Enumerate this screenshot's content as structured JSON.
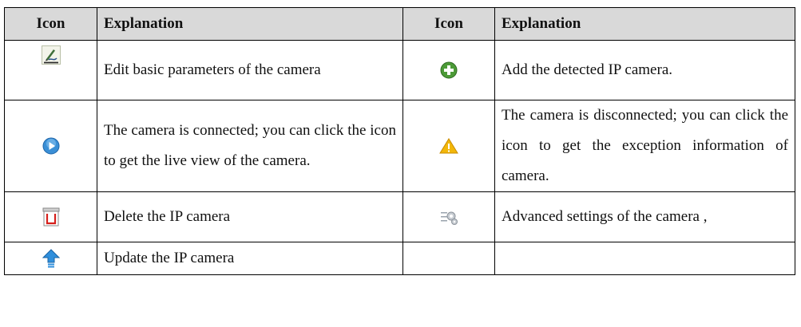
{
  "table": {
    "headers": [
      "Icon",
      "Explanation",
      "Icon",
      "Explanation"
    ],
    "rows": [
      {
        "left_icon": "edit-pen-icon",
        "left_text": "Edit basic parameters of the camera",
        "right_icon": "add-plus-icon",
        "right_text": "Add the detected IP camera."
      },
      {
        "left_icon": "live-view-play-icon",
        "left_text": "The camera is connected; you can click the icon to get the live view of the camera.",
        "right_icon": "warning-icon",
        "right_text": "The camera is disconnected; you can click the icon to get the exception information of camera."
      },
      {
        "left_icon": "delete-trash-icon",
        "left_text": "Delete the IP camera",
        "right_icon": "advanced-settings-icon",
        "right_text": "Advanced settings of the camera ,"
      },
      {
        "left_icon": "update-arrow-icon",
        "left_text": "Update the IP camera",
        "right_icon": "",
        "right_text": ""
      }
    ]
  }
}
